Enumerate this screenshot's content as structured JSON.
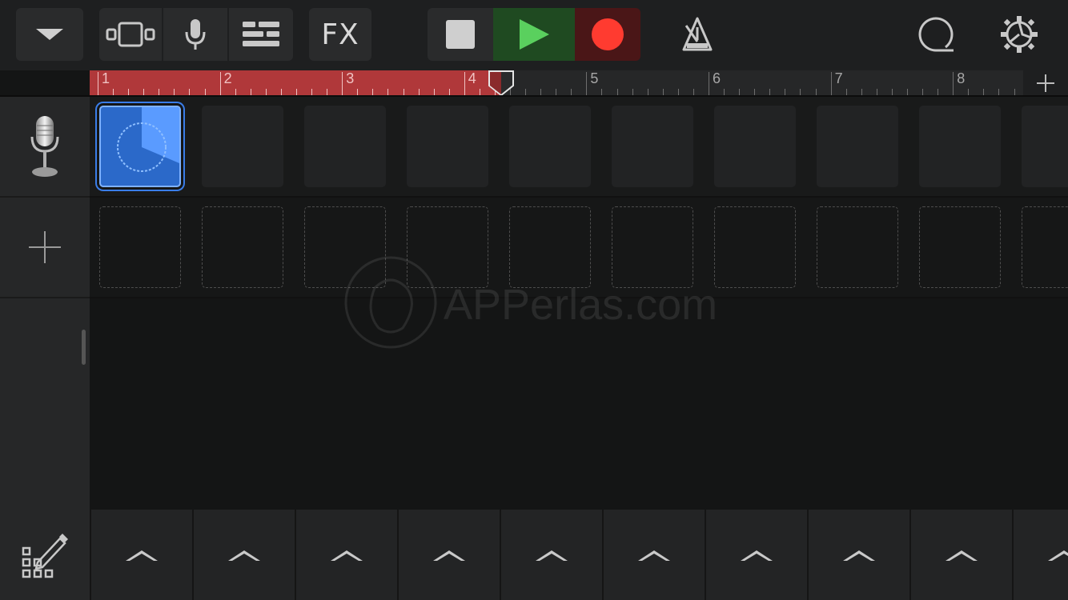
{
  "toolbar": {
    "fx_label": "FX",
    "buttons": {
      "browser": "chevron-down-icon",
      "tracks_view": "tracks-view-icon",
      "mic": "microphone-icon",
      "mixer": "controls-icon",
      "stop": "stop-icon",
      "play": "play-icon",
      "record": "record-icon",
      "metronome": "metronome-icon",
      "loop_browser": "loop-browser-icon",
      "settings": "gear-icon"
    },
    "colors": {
      "play_bg": "#1f4a21",
      "play_fg": "#5ad05e",
      "record_bg": "#4a1617",
      "record_fg": "#ff3b30"
    }
  },
  "ruler": {
    "bars": [
      "1",
      "2",
      "3",
      "4",
      "5",
      "6",
      "7",
      "8"
    ],
    "cycle_start_bar": 1,
    "cycle_end_bar": 4.3,
    "playhead_bar": 4.3,
    "cycle_color": "#b0383a"
  },
  "tracks": [
    {
      "instrument": "microphone-icon",
      "cells": [
        "loop",
        "empty",
        "empty",
        "empty",
        "empty",
        "empty",
        "empty",
        "empty",
        "empty",
        "empty"
      ]
    },
    {
      "instrument": "add-track-icon",
      "cells": [
        "placeholder",
        "placeholder",
        "placeholder",
        "placeholder",
        "placeholder",
        "placeholder",
        "placeholder",
        "placeholder",
        "placeholder",
        "placeholder"
      ]
    }
  ],
  "bottom_bar": {
    "edit_icon": "edit-grid-icon",
    "triggers": 10
  },
  "watermark": {
    "text": "APPerlas.com"
  }
}
